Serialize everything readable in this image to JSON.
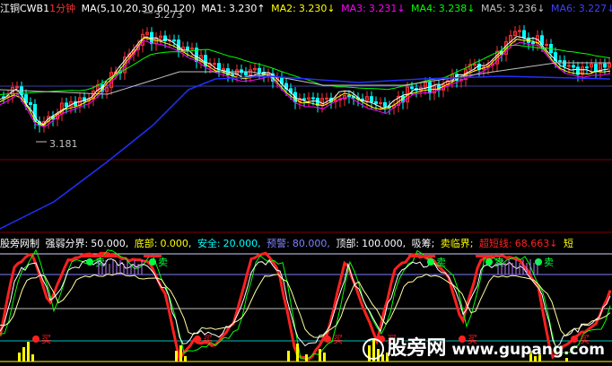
{
  "top_header": {
    "symbol": "江铜CWB1",
    "period": "1分钟",
    "ma_params": "MA(5,10,20,30,60,120)",
    "ma1": {
      "label": "MA1:",
      "value": "3.230↑",
      "color": "#ffffff"
    },
    "ma2": {
      "label": "MA2:",
      "value": "3.230↓",
      "color": "#ffff00"
    },
    "ma3": {
      "label": "MA3:",
      "value": "3.231↓",
      "color": "#ff00ff"
    },
    "ma4": {
      "label": "MA4:",
      "value": "3.238↓",
      "color": "#00ff00"
    },
    "ma5": {
      "label": "MA5:",
      "value": "3.236↓",
      "color": "#c0c0c0"
    },
    "ma6": {
      "label": "MA6:",
      "value": "3.227↓",
      "color": "#4040ff"
    }
  },
  "price_annotations": {
    "high": "3.273",
    "low": "3.181"
  },
  "bottom_header": {
    "name": "股旁网制",
    "f1": {
      "label": "强弱分界:",
      "value": "50.000,"
    },
    "f2": {
      "label": "底部:",
      "value": "0.000,"
    },
    "f3": {
      "label": "安全:",
      "value": "20.000,"
    },
    "f4": {
      "label": "预警:",
      "value": "80.000,"
    },
    "f5": {
      "label": "顶部:",
      "value": "100.000,"
    },
    "f6": {
      "label": "吸筹;"
    },
    "f7": {
      "label": "卖临界;"
    },
    "f8": {
      "label": "超短线:",
      "value": "68.663↓"
    },
    "f9": {
      "label": "短"
    }
  },
  "signals": {
    "sell": "卖",
    "buy": "买"
  },
  "watermark": {
    "name": "股旁网",
    "url": "www.gupang.com"
  },
  "colors": {
    "up": "#ff3030",
    "down": "#00ffff",
    "ma_long": "#2030ff",
    "indicator": "#ff2020"
  }
}
